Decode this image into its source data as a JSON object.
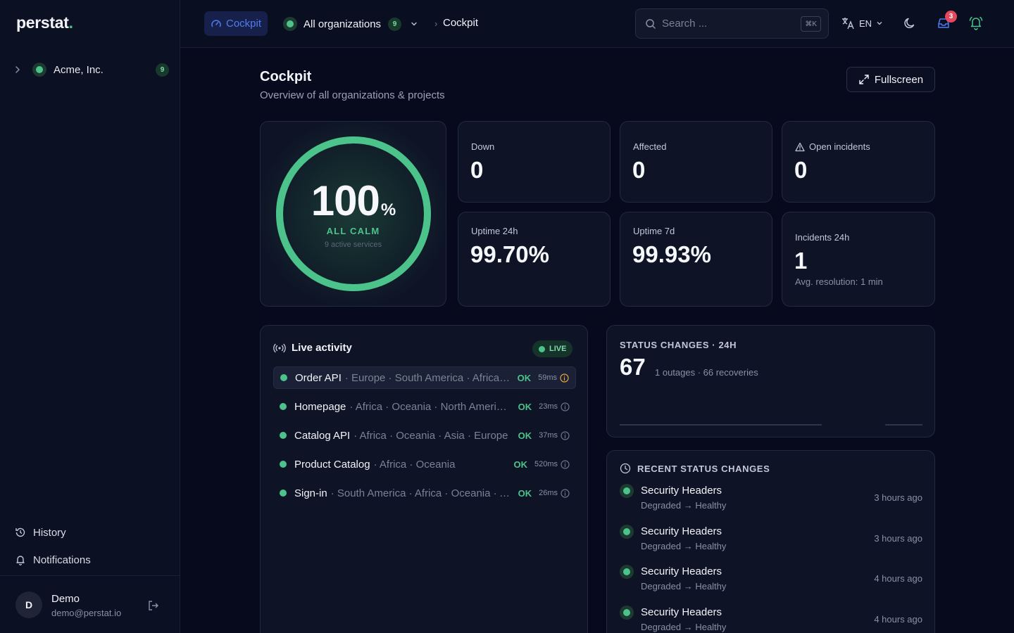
{
  "brand": {
    "name": "perstat",
    "dot": "."
  },
  "sidebar": {
    "org": {
      "name": "Acme, Inc.",
      "count": "9"
    },
    "links": [
      {
        "label": "History"
      },
      {
        "label": "Notifications"
      }
    ],
    "user": {
      "initial": "D",
      "name": "Demo",
      "email": "demo@perstat.io"
    }
  },
  "topbar": {
    "tab_label": "Cockpit",
    "org_select": {
      "label": "All organizations",
      "count": "9"
    },
    "breadcrumb": "Cockpit",
    "search": {
      "placeholder": "Search ...",
      "shortcut": "⌘K"
    },
    "language": "EN",
    "notifications_count": "3"
  },
  "page": {
    "title": "Cockpit",
    "subtitle": "Overview of all organizations & projects",
    "fullscreen_label": "Fullscreen"
  },
  "gauge": {
    "value": "100",
    "unit": "%",
    "status": "ALL CALM",
    "services": "9 active services",
    "fraction": 1.0
  },
  "stats": {
    "down": {
      "label": "Down",
      "value": "0"
    },
    "affected": {
      "label": "Affected",
      "value": "0"
    },
    "open_incidents": {
      "label": "Open incidents",
      "value": "0"
    },
    "uptime_24h": {
      "label": "Uptime 24h",
      "value": "99.70%"
    },
    "uptime_7d": {
      "label": "Uptime 7d",
      "value": "99.93%"
    },
    "incidents_24h": {
      "label": "Incidents 24h",
      "value": "1",
      "foot": "Avg. resolution: 1 min"
    }
  },
  "live": {
    "title": "Live activity",
    "badge": "LIVE",
    "rows": [
      {
        "name": "Order API",
        "regions": "· Europe · South America · Africa · Oceania",
        "status": "OK",
        "latency": "59ms"
      },
      {
        "name": "Homepage",
        "regions": "· Africa · Oceania · North America · Europe",
        "status": "OK",
        "latency": "23ms"
      },
      {
        "name": "Catalog API",
        "regions": "· Africa · Oceania · Asia · Europe",
        "status": "OK",
        "latency": "37ms"
      },
      {
        "name": "Product Catalog",
        "regions": "· Africa · Oceania",
        "status": "OK",
        "latency": "520ms"
      },
      {
        "name": "Sign-in",
        "regions": "· South America · Africa · Oceania · Asia",
        "status": "OK",
        "latency": "26ms"
      }
    ]
  },
  "status_changes": {
    "title": "STATUS CHANGES · 24H",
    "count": "67",
    "summary": "1 outages · 66 recoveries"
  },
  "recent": {
    "title": "RECENT STATUS CHANGES",
    "items": [
      {
        "name": "Security Headers",
        "transition": "Degraded → Healthy",
        "time": "3 hours ago"
      },
      {
        "name": "Security Headers",
        "transition": "Degraded → Healthy",
        "time": "3 hours ago"
      },
      {
        "name": "Security Headers",
        "transition": "Degraded → Healthy",
        "time": "4 hours ago"
      },
      {
        "name": "Security Headers",
        "transition": "Degraded → Healthy",
        "time": "4 hours ago"
      }
    ]
  },
  "colors": {
    "accent": "#4f7cf0",
    "healthy": "#4cc38a",
    "danger": "#e5485b",
    "background": "#060a1c"
  }
}
